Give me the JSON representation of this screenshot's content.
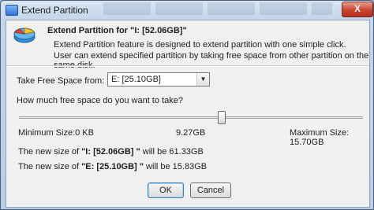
{
  "window": {
    "title": "Extend Partition",
    "close_label": "X"
  },
  "header": {
    "title": "Extend Partition for \"I: [52.06GB]\"",
    "description_line1": "Extend Partition feature is designed to extend partition with one simple click.",
    "description_line2": "User can extend specified partition by taking free space from other partition on the same disk."
  },
  "source": {
    "label": "Take Free Space from:",
    "selected": "E:  [25.10GB]"
  },
  "amount": {
    "question": "How much free space do you want to take?",
    "min_label": "Minimum Size:0 KB",
    "current_label": "9.27GB",
    "max_label": "Maximum Size: 15.70GB",
    "current_gb": 9.27,
    "max_gb": 15.7
  },
  "summary": {
    "line1": {
      "prefix": "The new size of ",
      "partition": "\"I: [52.06GB] \"",
      "suffix": " will be 61.33GB"
    },
    "line2": {
      "prefix": "The new size of ",
      "partition": "\"E: [25.10GB] \"",
      "suffix": " will be 15.83GB"
    }
  },
  "buttons": {
    "ok": "OK",
    "cancel": "Cancel"
  },
  "colors": {
    "accent": "#3c7fb1",
    "close": "#c9422a"
  }
}
